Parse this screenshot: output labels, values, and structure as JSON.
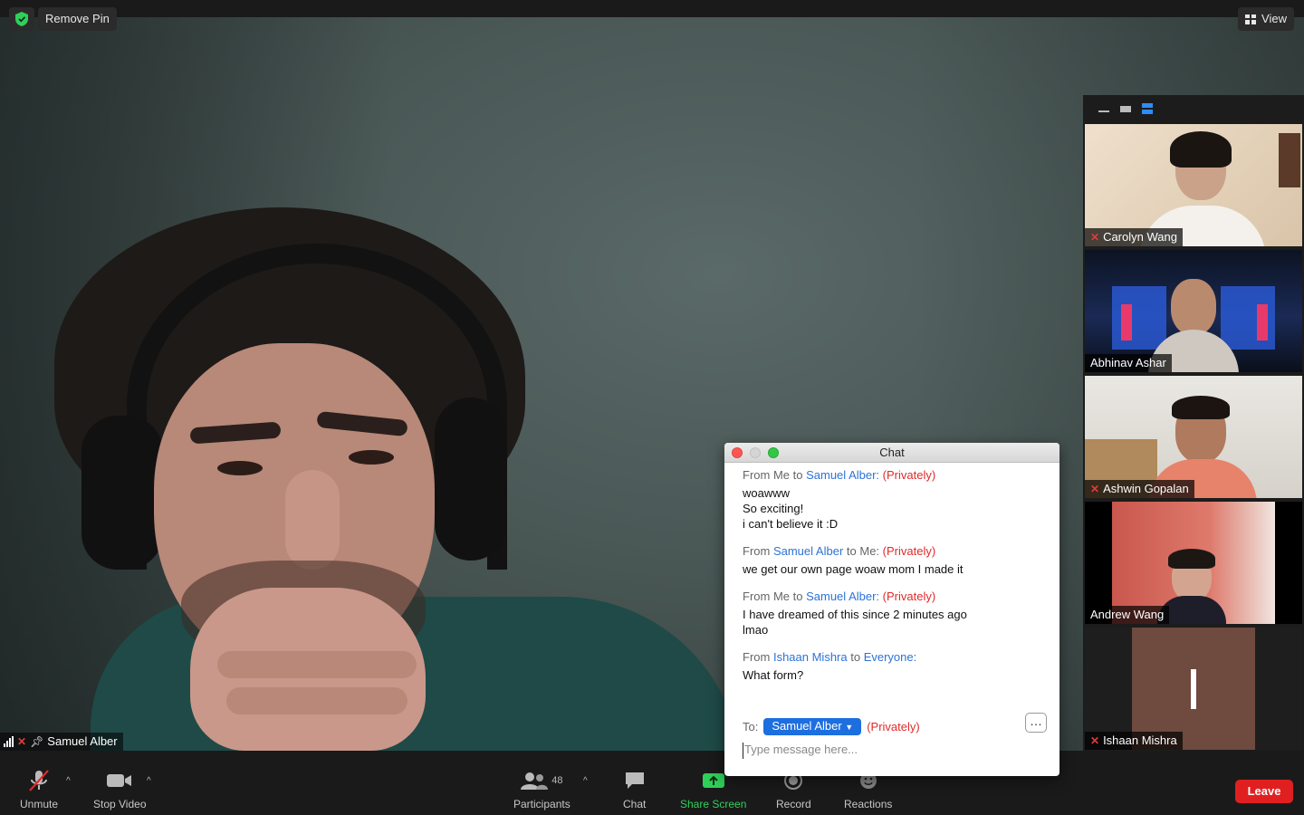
{
  "topbar": {
    "remove_pin_label": "Remove Pin",
    "view_label": "View",
    "shield_color": "#2fd05a"
  },
  "main_speaker": {
    "name": "Samuel Alber",
    "icons": [
      "signal-icon",
      "mic-muted-icon",
      "pin-icon"
    ]
  },
  "gallery": {
    "tiles": [
      {
        "name": "Carolyn Wang",
        "muted": true
      },
      {
        "name": "Abhinav Ashar",
        "muted": false
      },
      {
        "name": "Ashwin Gopalan",
        "muted": true
      },
      {
        "name": "Andrew Wang",
        "muted": false
      },
      {
        "name": "Ishaan Mishra",
        "muted": true,
        "avatar_letter": "I"
      }
    ]
  },
  "chat": {
    "title": "Chat",
    "messages": [
      {
        "from_prefix": "From ",
        "from": "Me",
        "to_word": " to ",
        "to": "Samuel Alber",
        "colon": ":",
        "privacy": "(Privately)",
        "lines": [
          "woawww",
          "So exciting!",
          "i can't believe it :D"
        ]
      },
      {
        "from_prefix": "From ",
        "from": "Samuel Alber",
        "to_word": " to ",
        "to": "Me",
        "colon": ":",
        "privacy": "(Privately)",
        "lines": [
          "we get our own page woaw mom I made it"
        ]
      },
      {
        "from_prefix": "From ",
        "from": "Me",
        "to_word": " to ",
        "to": "Samuel Alber",
        "colon": ":",
        "privacy": "(Privately)",
        "lines": [
          "I have dreamed of this since 2 minutes ago",
          "lmao"
        ]
      },
      {
        "from_prefix": "From ",
        "from": "Ishaan Mishra",
        "to_word": " to ",
        "to": "Everyone",
        "colon": ":",
        "privacy": "",
        "lines": [
          "What form?"
        ]
      }
    ],
    "to_label": "To:",
    "recipient": "Samuel Alber",
    "recipient_privacy": "(Privately)",
    "more_label": "…",
    "placeholder": "Type message here..."
  },
  "toolbar": {
    "unmute": "Unmute",
    "stop_video": "Stop Video",
    "participants": "Participants",
    "participants_count": "48",
    "chat": "Chat",
    "share_screen": "Share Screen",
    "record": "Record",
    "reactions": "Reactions",
    "leave": "Leave",
    "share_color": "#2fd05a",
    "leave_color": "#e02020"
  }
}
